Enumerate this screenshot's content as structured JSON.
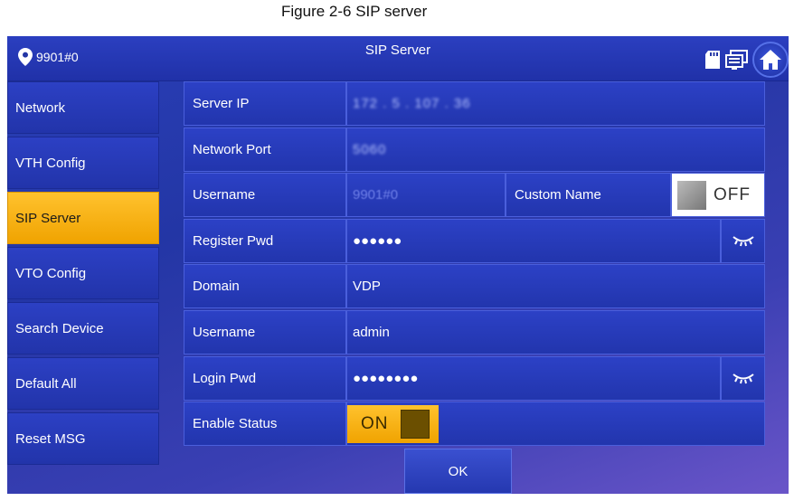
{
  "caption": "Figure 2-6 SIP server",
  "header": {
    "room": "9901#0",
    "title": "SIP Server",
    "icons": [
      "location-pin-icon",
      "sd-card-icon",
      "network-icon",
      "home-icon"
    ]
  },
  "sidebar": {
    "items": [
      {
        "label": "Network"
      },
      {
        "label": "VTH Config"
      },
      {
        "label": "SIP Server",
        "active": true
      },
      {
        "label": "VTO Config"
      },
      {
        "label": "Search Device"
      },
      {
        "label": "Default All"
      },
      {
        "label": "Reset MSG"
      }
    ]
  },
  "form": {
    "server_ip": {
      "label": "Server IP",
      "value": "172 . 5 . 107 . 36"
    },
    "network_port": {
      "label": "Network Port",
      "value": "5060"
    },
    "username1": {
      "label": "Username",
      "value": "9901#0"
    },
    "custom_name": {
      "label": "Custom Name",
      "toggle": "OFF"
    },
    "register_pwd": {
      "label": "Register Pwd",
      "value": "●●●●●●"
    },
    "domain": {
      "label": "Domain",
      "value": "VDP"
    },
    "username2": {
      "label": "Username",
      "value": "admin"
    },
    "login_pwd": {
      "label": "Login Pwd",
      "value": "●●●●●●●●"
    },
    "enable_status": {
      "label": "Enable Status",
      "toggle": "ON"
    }
  },
  "ok_label": "OK",
  "colors": {
    "screen_blue": "#2336a5",
    "active_yellow": "#f0a300",
    "border_blue": "#4a5fdc"
  }
}
